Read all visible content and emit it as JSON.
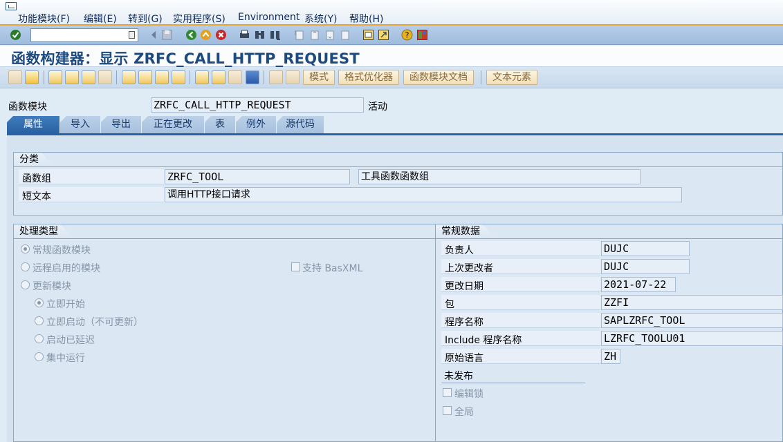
{
  "menu": {
    "items": [
      "功能模块(F)",
      "编辑(E)",
      "转到(G)",
      "实用程序(S)",
      "Environment",
      "系统(Y)",
      "帮助(H)"
    ]
  },
  "system_toolbar": {
    "command_value": "",
    "icons": [
      "enter-check-icon",
      "back-icon",
      "save-icon",
      "back-green-icon",
      "exit-icon",
      "cancel-icon",
      "print-icon",
      "find-icon",
      "find-next-icon",
      "first-page-icon",
      "prev-page-icon",
      "next-page-icon",
      "last-page-icon",
      "create-session-icon",
      "shortcut-icon",
      "help-icon",
      "layout-icon"
    ]
  },
  "title": "函数构建器：显示 ZRFC_CALL_HTTP_REQUEST",
  "app_toolbar": {
    "buttons": [
      "模式",
      "格式优化器",
      "函数模块文档",
      "文本元素"
    ]
  },
  "header": {
    "function_module_label": "函数模块",
    "function_module_value": "ZRFC_CALL_HTTP_REQUEST",
    "status": "活动"
  },
  "tabs": [
    "属性",
    "导入",
    "导出",
    "正在更改",
    "表",
    "例外",
    "源代码"
  ],
  "classification": {
    "title": "分类",
    "group_label": "函数组",
    "group_value": "ZRFC_TOOL",
    "group_desc": "工具函数函数组",
    "short_text_label": "短文本",
    "short_text_value": "调用HTTP接口请求"
  },
  "processing_type": {
    "title": "处理类型",
    "options": [
      "常规函数模块",
      "远程启用的模块",
      "更新模块"
    ],
    "basxml_label": "支持 BasXML",
    "update_options": [
      "立即开始",
      "立即启动（不可更新）",
      "启动已延迟",
      "集中运行"
    ]
  },
  "general_data": {
    "title": "常规数据",
    "rows": [
      {
        "label": "负责人",
        "value": "DUJC"
      },
      {
        "label": "上次更改者",
        "value": "DUJC"
      },
      {
        "label": "更改日期",
        "value": "2021-07-22"
      },
      {
        "label": "包",
        "value": "ZZFI"
      },
      {
        "label": "程序名称",
        "value": "SAPLZRFC_TOOL"
      },
      {
        "label": "Include 程序名称",
        "value": "LZRFC_TOOLU01"
      },
      {
        "label": "原始语言",
        "value": "ZH"
      }
    ],
    "not_released": "未发布",
    "edit_lock": "编辑锁",
    "global": "全局"
  }
}
